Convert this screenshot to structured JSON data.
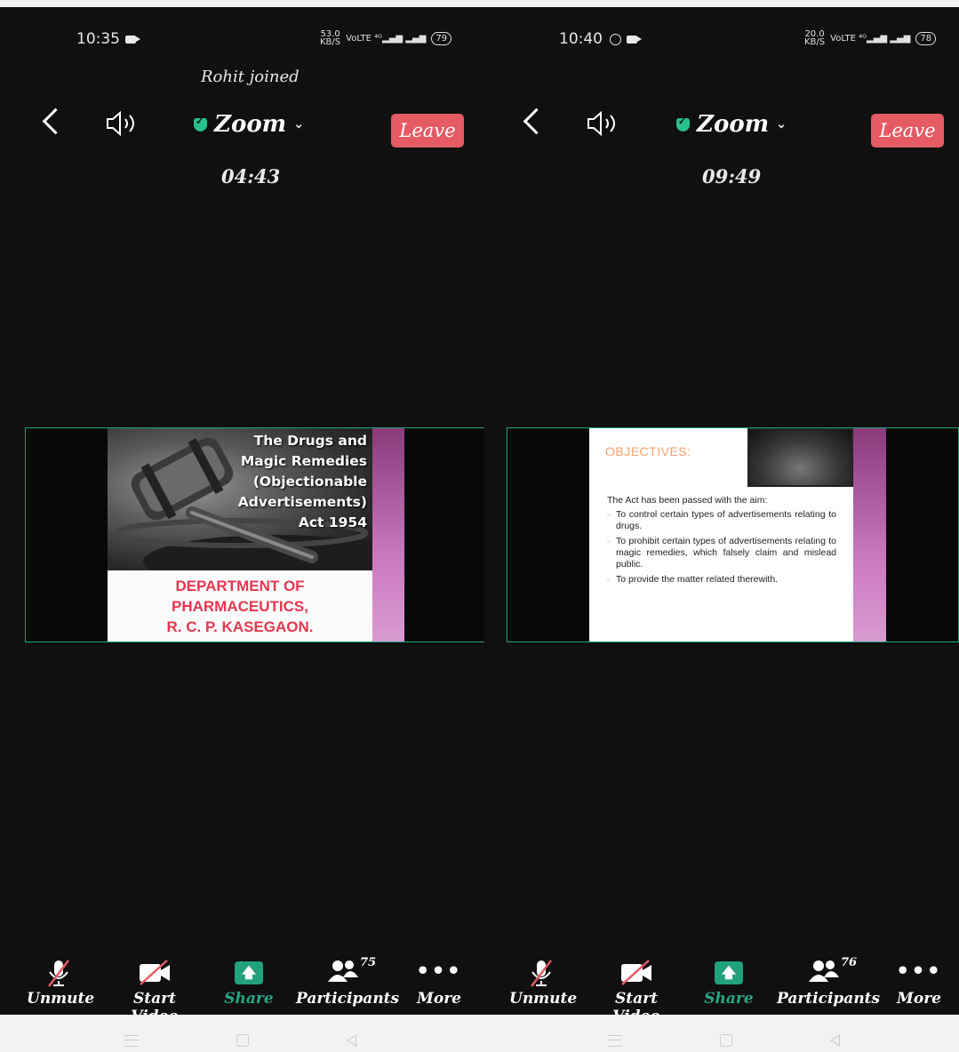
{
  "left": {
    "status": {
      "time": "10:35",
      "speed_value": "53.0",
      "speed_unit": "KB/S",
      "battery": "79"
    },
    "notification": "Rohit joined",
    "header": {
      "title": "Zoom",
      "leave_label": "Leave",
      "timer": "04:43"
    },
    "slide": {
      "title_lines": [
        "The Drugs and",
        "Magic Remedies",
        "(Objectionable",
        "Advertisements)",
        "Act 1954"
      ],
      "dept_lines": [
        "DEPARTMENT OF",
        "PHARMACEUTICS,",
        "R. C. P. KASEGAON."
      ]
    },
    "toolbar": {
      "unmute": "Unmute",
      "start_video": "Start Video",
      "share": "Share",
      "participants": "Participants",
      "participants_count": "75",
      "more": "More"
    }
  },
  "right": {
    "status": {
      "time": "10:40",
      "speed_value": "20.0",
      "speed_unit": "KB/S",
      "battery": "78"
    },
    "header": {
      "title": "Zoom",
      "leave_label": "Leave",
      "timer": "09:49"
    },
    "slide": {
      "heading": "OBJECTIVES:",
      "intro": "The Act has been passed with the aim:",
      "bullets": [
        "To control certain types of advertisements relating to drugs.",
        "To prohibit certain types of advertisements relating to magic remedies, which falsely claim and mislead public.",
        "To provide the matter related therewith."
      ]
    },
    "toolbar": {
      "unmute": "Unmute",
      "start_video": "Start Video",
      "share": "Share",
      "participants": "Participants",
      "participants_count": "76",
      "more": "More"
    }
  },
  "colors": {
    "leave_bg": "#e45b64",
    "share_green": "#21a17c",
    "frame_green": "#1fa37a",
    "dept_red": "#e33850",
    "objective_orange": "#f0a070",
    "slide_stripe": "#c978c0"
  }
}
